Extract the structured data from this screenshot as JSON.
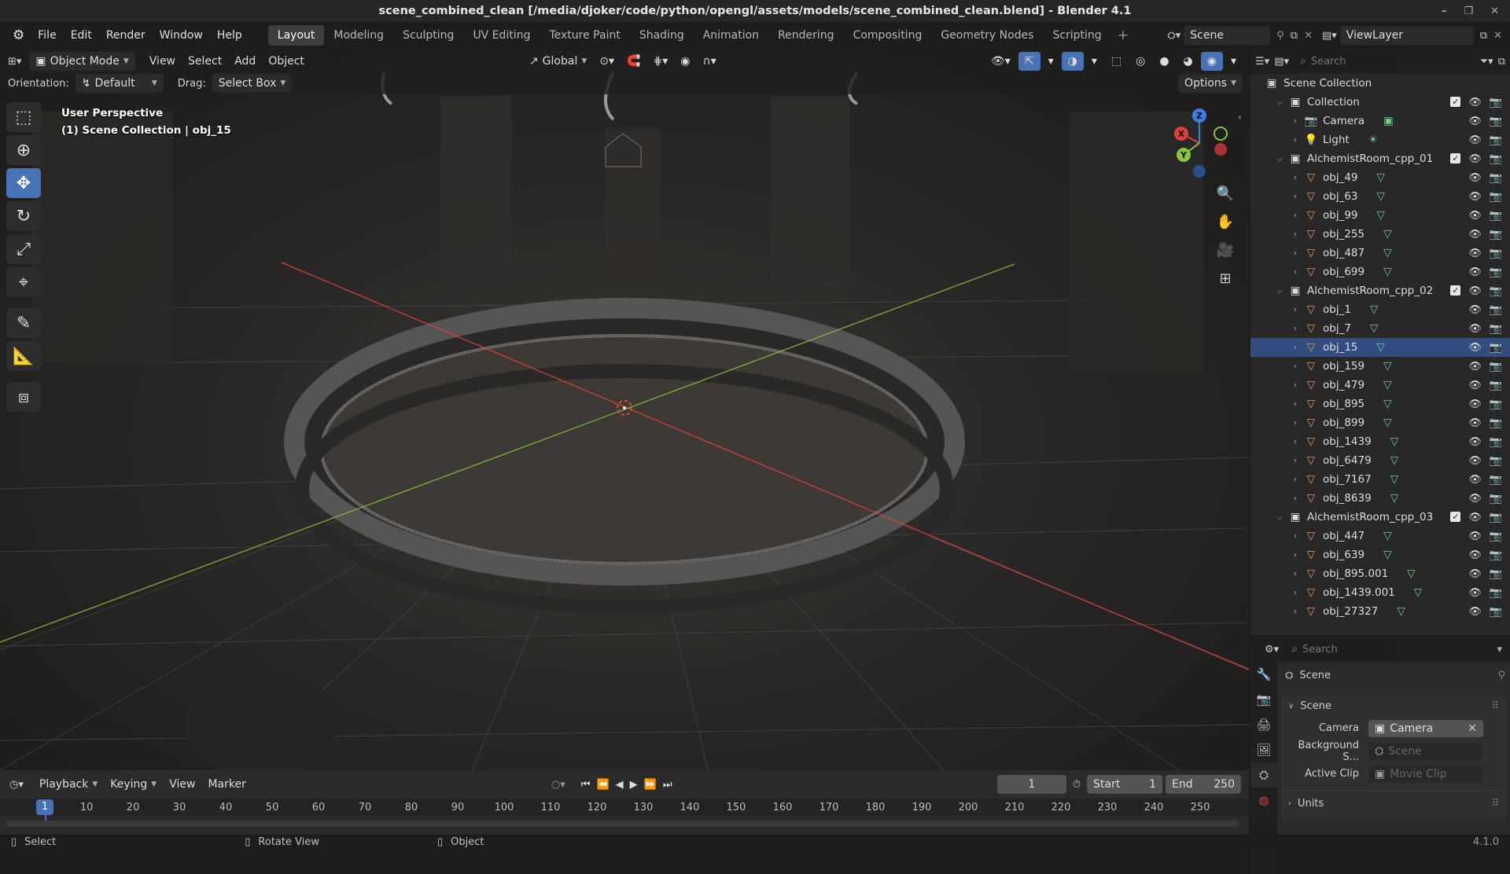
{
  "window": {
    "title": "scene_combined_clean [/media/djoker/code/python/opengl/assets/models/scene_combined_clean.blend] - Blender 4.1"
  },
  "menu": [
    "File",
    "Edit",
    "Render",
    "Window",
    "Help"
  ],
  "workspaces": [
    "Layout",
    "Modeling",
    "Sculpting",
    "UV Editing",
    "Texture Paint",
    "Shading",
    "Animation",
    "Rendering",
    "Compositing",
    "Geometry Nodes",
    "Scripting"
  ],
  "active_workspace": "Layout",
  "scene_field": "Scene",
  "viewlayer_field": "ViewLayer",
  "viewport": {
    "mode": "Object Mode",
    "menus": [
      "View",
      "Select",
      "Add",
      "Object"
    ],
    "transform_orientation": "Global",
    "orientation_label": "Orientation:",
    "orientation_value": "Default",
    "drag_label": "Drag:",
    "drag_value": "Select Box",
    "options_label": "Options",
    "info_line1": "User Perspective",
    "info_line2": "(1) Scene Collection | obj_15",
    "gizmo": {
      "x": "X",
      "y": "Y",
      "z": "Z"
    }
  },
  "outliner": {
    "search_placeholder": "Search",
    "root": "Scene Collection",
    "rows": [
      {
        "type": "collection",
        "label": "Collection",
        "level": 1,
        "expanded": true,
        "selected": false
      },
      {
        "type": "camera",
        "label": "Camera",
        "level": 2,
        "expanded": false,
        "selected": false
      },
      {
        "type": "light",
        "label": "Light",
        "level": 2,
        "expanded": false,
        "selected": false
      },
      {
        "type": "collection",
        "label": "AlchemistRoom_cpp_01",
        "level": 1,
        "expanded": true,
        "selected": false
      },
      {
        "type": "mesh",
        "label": "obj_49",
        "level": 2,
        "selected": false
      },
      {
        "type": "mesh",
        "label": "obj_63",
        "level": 2,
        "selected": false
      },
      {
        "type": "mesh",
        "label": "obj_99",
        "level": 2,
        "selected": false
      },
      {
        "type": "mesh",
        "label": "obj_255",
        "level": 2,
        "selected": false
      },
      {
        "type": "mesh",
        "label": "obj_487",
        "level": 2,
        "selected": false
      },
      {
        "type": "mesh",
        "label": "obj_699",
        "level": 2,
        "selected": false
      },
      {
        "type": "collection",
        "label": "AlchemistRoom_cpp_02",
        "level": 1,
        "expanded": true,
        "selected": false
      },
      {
        "type": "mesh",
        "label": "obj_1",
        "level": 2,
        "selected": false
      },
      {
        "type": "mesh",
        "label": "obj_7",
        "level": 2,
        "selected": false
      },
      {
        "type": "mesh",
        "label": "obj_15",
        "level": 2,
        "selected": true
      },
      {
        "type": "mesh",
        "label": "obj_159",
        "level": 2,
        "selected": false
      },
      {
        "type": "mesh",
        "label": "obj_479",
        "level": 2,
        "selected": false
      },
      {
        "type": "mesh",
        "label": "obj_895",
        "level": 2,
        "selected": false
      },
      {
        "type": "mesh",
        "label": "obj_899",
        "level": 2,
        "selected": false
      },
      {
        "type": "mesh",
        "label": "obj_1439",
        "level": 2,
        "selected": false
      },
      {
        "type": "mesh",
        "label": "obj_6479",
        "level": 2,
        "selected": false
      },
      {
        "type": "mesh",
        "label": "obj_7167",
        "level": 2,
        "selected": false
      },
      {
        "type": "mesh",
        "label": "obj_8639",
        "level": 2,
        "selected": false
      },
      {
        "type": "collection",
        "label": "AlchemistRoom_cpp_03",
        "level": 1,
        "expanded": true,
        "selected": false
      },
      {
        "type": "mesh",
        "label": "obj_447",
        "level": 2,
        "selected": false
      },
      {
        "type": "mesh",
        "label": "obj_639",
        "level": 2,
        "selected": false
      },
      {
        "type": "mesh",
        "label": "obj_895.001",
        "level": 2,
        "selected": false
      },
      {
        "type": "mesh",
        "label": "obj_1439.001",
        "level": 2,
        "selected": false
      },
      {
        "type": "mesh",
        "label": "obj_27327",
        "level": 2,
        "selected": false
      }
    ]
  },
  "properties": {
    "search_placeholder": "Search",
    "context": "Scene",
    "panel_title": "Scene",
    "camera_label": "Camera",
    "camera_value": "Camera",
    "background_label": "Background S...",
    "background_placeholder": "Scene",
    "active_clip_label": "Active Clip",
    "active_clip_placeholder": "Movie Clip",
    "units_label": "Units"
  },
  "timeline": {
    "menus": [
      "Playback",
      "Keying",
      "View",
      "Marker"
    ],
    "current_frame": "1",
    "start_label": "Start",
    "start_value": "1",
    "end_label": "End",
    "end_value": "250",
    "ticks": [
      "1",
      "10",
      "20",
      "30",
      "40",
      "50",
      "60",
      "70",
      "80",
      "90",
      "100",
      "110",
      "120",
      "130",
      "140",
      "150",
      "160",
      "170",
      "180",
      "190",
      "200",
      "210",
      "220",
      "230",
      "240",
      "250"
    ]
  },
  "statusbar": {
    "select": "Select",
    "rotate": "Rotate View",
    "object": "Object",
    "version": "4.1.0"
  },
  "colors": {
    "accent": "#4772b3",
    "selected_row": "#334d80",
    "x_axis": "#e0403f",
    "y_axis": "#8bc43f",
    "z_axis": "#3d7ee6"
  }
}
